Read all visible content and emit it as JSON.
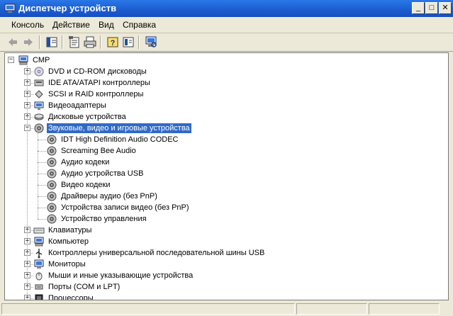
{
  "window": {
    "title": "Диспетчер устройств",
    "controls": {
      "minimize": "_",
      "maximize": "□",
      "close": "✕"
    }
  },
  "menu": [
    "Консоль",
    "Действие",
    "Вид",
    "Справка"
  ],
  "toolbar": {
    "icons": [
      "back-arrow-icon",
      "forward-arrow-icon",
      "show-hide-tree-icon",
      "properties-icon",
      "print-icon",
      "help-icon",
      "view-icon",
      "scan-hardware-icon"
    ]
  },
  "tree": {
    "root": "СМР",
    "categories": [
      {
        "label": "DVD и CD-ROM дисководы",
        "icon": "cdrom-icon",
        "expanded": false
      },
      {
        "label": "IDE ATA/ATAPI контроллеры",
        "icon": "ide-controller-icon",
        "expanded": false
      },
      {
        "label": "SCSI и RAID контроллеры",
        "icon": "scsi-icon",
        "expanded": false
      },
      {
        "label": "Видеоадаптеры",
        "icon": "display-adapter-icon",
        "expanded": false
      },
      {
        "label": "Дисковые устройства",
        "icon": "disk-drive-icon",
        "expanded": false
      },
      {
        "label": "Звуковые, видео и игровые устройства",
        "icon": "sound-icon",
        "expanded": true,
        "selected": true,
        "children": [
          "IDT High Definition Audio CODEC",
          "Screaming Bee Audio",
          "Аудио кодеки",
          "Аудио устройства USB",
          "Видео кодеки",
          "Драйверы аудио (без PnP)",
          "Устройства записи видео (без PnP)",
          "Устройство управления"
        ]
      },
      {
        "label": "Клавиатуры",
        "icon": "keyboard-icon",
        "expanded": false
      },
      {
        "label": "Компьютер",
        "icon": "computer-icon",
        "expanded": false
      },
      {
        "label": "Контроллеры универсальной последовательной шины USB",
        "icon": "usb-icon",
        "expanded": false
      },
      {
        "label": "Мониторы",
        "icon": "monitor-icon",
        "expanded": false
      },
      {
        "label": "Мыши и иные указывающие устройства",
        "icon": "mouse-icon",
        "expanded": false
      },
      {
        "label": "Порты (COM и LPT)",
        "icon": "port-icon",
        "expanded": false
      },
      {
        "label": "Процессоры",
        "icon": "processor-icon",
        "expanded": false
      }
    ]
  },
  "colors": {
    "titlebar": "#1a5ccf",
    "selection": "#316ac5",
    "chrome": "#ece9d8"
  }
}
